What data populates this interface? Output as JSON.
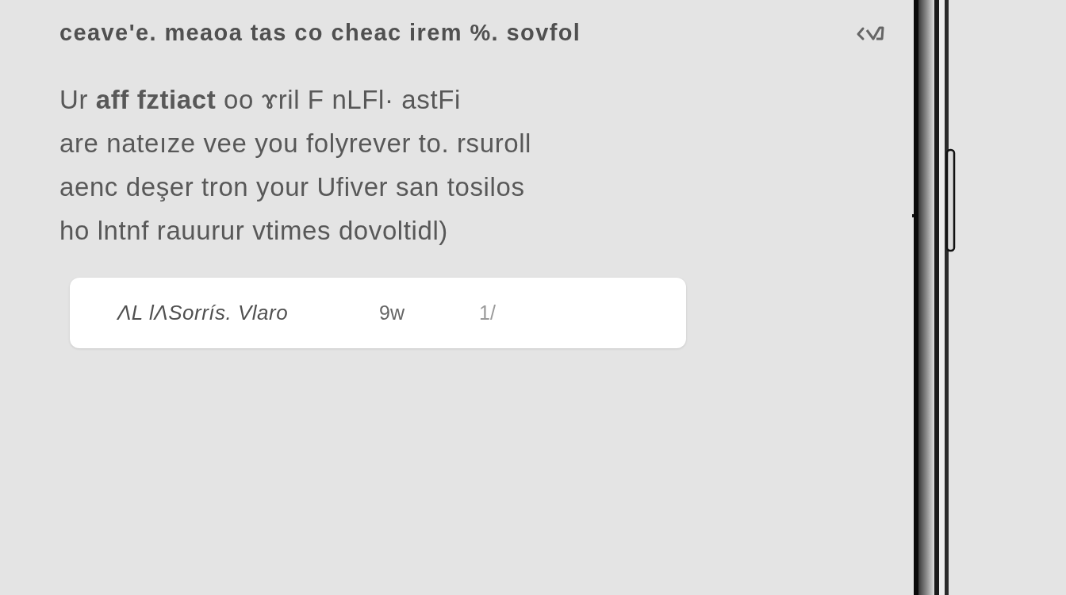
{
  "header": {
    "title": "ceave'e. meaoa tas co cheac irem %. sovfol"
  },
  "body": {
    "lines": [
      "Ur **aff fztiact** oo ɤril F nLFl· astFi",
      "are nateıze vee you folyrever to. rsuroll",
      "aenc deşer tron your Ufiver san tosilos",
      "ho lntnf rauurur vtimes dovoltidl)"
    ]
  },
  "card": {
    "items": [
      {
        "kind": "label",
        "text": "ΛL lɅSorrís. Vlaro"
      },
      {
        "kind": "value",
        "text": "9w"
      },
      {
        "kind": "faint",
        "text": "1/"
      }
    ]
  }
}
